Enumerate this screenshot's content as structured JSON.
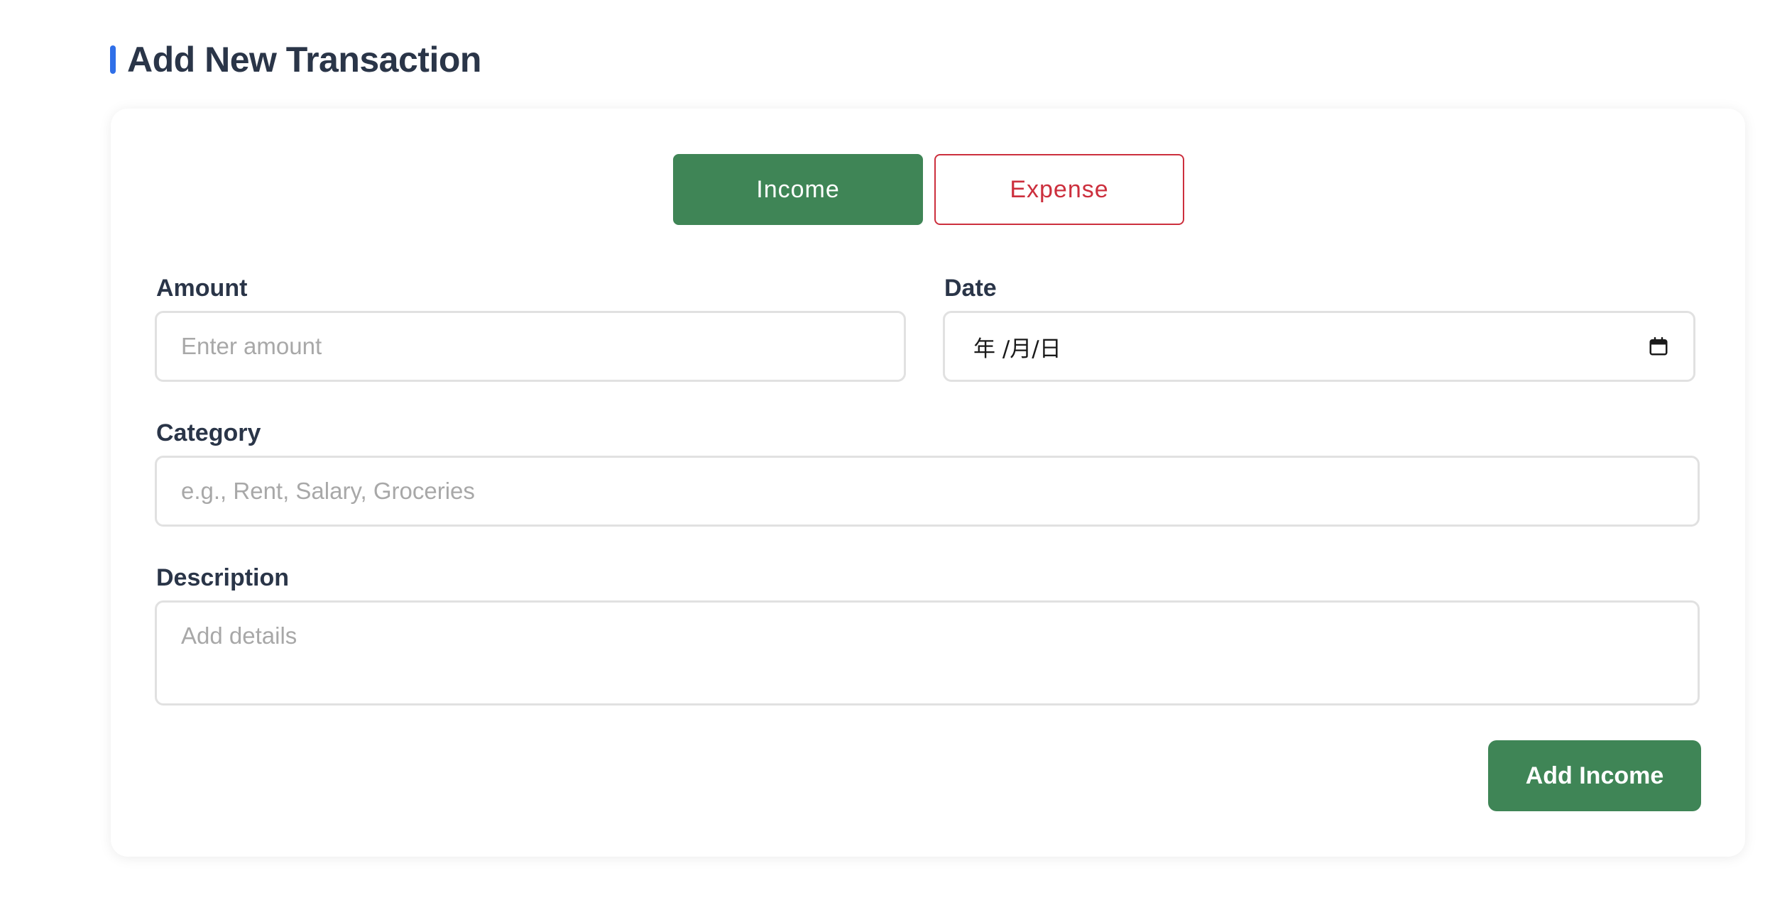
{
  "page": {
    "title": "Add New Transaction"
  },
  "type_toggle": {
    "income_label": "Income",
    "expense_label": "Expense",
    "selected": "Income"
  },
  "fields": {
    "amount": {
      "label": "Amount",
      "value": "",
      "placeholder": "Enter amount"
    },
    "date": {
      "label": "Date",
      "display": "年 /月/日",
      "icon": "calendar-icon"
    },
    "category": {
      "label": "Category",
      "value": "",
      "placeholder": "e.g., Rent, Salary, Groceries"
    },
    "description": {
      "label": "Description",
      "value": "",
      "placeholder": "Add details"
    }
  },
  "submit": {
    "label": "Add Income"
  },
  "colors": {
    "accent": "#2f6fe8",
    "income": "#3f8556",
    "expense": "#cc2f3d",
    "title": "#2a3548",
    "input_border": "#e1e1e1",
    "placeholder": "#a8a8a8"
  }
}
